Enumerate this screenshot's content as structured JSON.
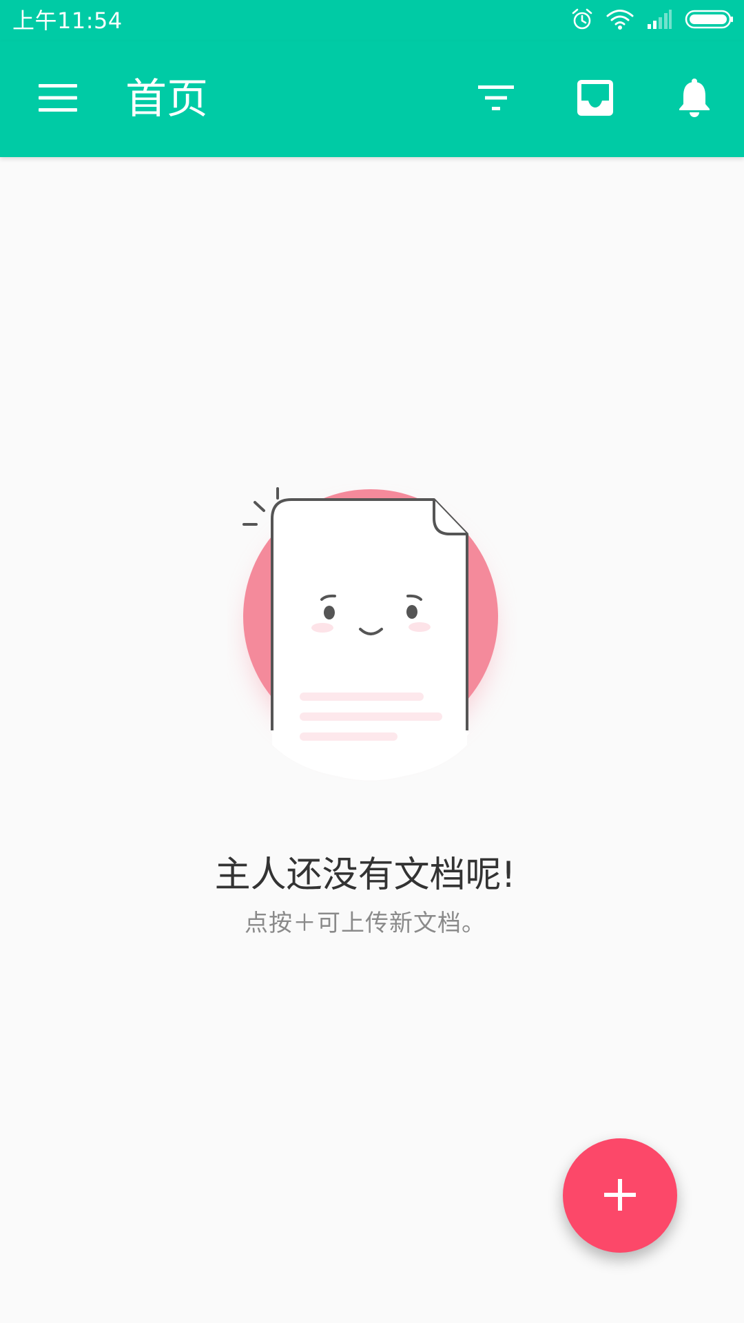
{
  "status_bar": {
    "time": "上午11:54",
    "icons": [
      "alarm-icon",
      "wifi-icon",
      "signal-icon",
      "battery-icon"
    ]
  },
  "toolbar": {
    "title": "首页",
    "icons": [
      "menu-icon",
      "filter-icon",
      "inbox-icon",
      "bell-icon"
    ]
  },
  "empty_state": {
    "title": "主人还没有文档呢!",
    "hint": "点按＋可上传新文档。"
  },
  "fab": {
    "icon": "plus-icon"
  },
  "colors": {
    "primary": "#00cba5",
    "accent": "#fc4869",
    "background": "#fafafa",
    "illustration_circle": "#f48a9b"
  }
}
